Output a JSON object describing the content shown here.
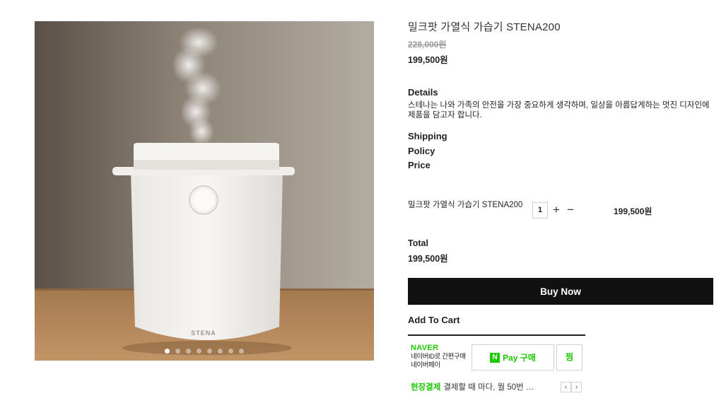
{
  "product": {
    "title": "밀크팟 가열식 가습기 STENA200",
    "original_price": "228,000원",
    "sale_price": "199,500원",
    "image_brand_text": "STENA",
    "gallery_dots": 8,
    "gallery_active_dot": 1
  },
  "details": {
    "heading": "Details",
    "text": "스테나는 나와 가족의 안전을 가장 중요하게 생각하며, 일상을 아름답게하는 멋진 디자인에 제품을 담고자 합니다."
  },
  "meta_links": {
    "shipping": "Shipping",
    "policy": "Policy",
    "price": "Price"
  },
  "option": {
    "name": "밀크팟 가열식 가습기 STENA200",
    "quantity": "1",
    "plus_label": "+",
    "minus_label": "−",
    "price": "199,500원"
  },
  "total": {
    "label": "Total",
    "value": "199,500원"
  },
  "buttons": {
    "buy_now": "Buy Now",
    "add_to_cart": "Add To Cart"
  },
  "naver_pay": {
    "logo": "NAVER",
    "description_line1": "네이버ID로 간편구매",
    "description_line2": "네이버페이",
    "badge": "N",
    "pay_label": "Pay 구매",
    "wish_label": "찜",
    "notice_tag": "현장결제",
    "notice_text": "결제할 때 마다, 월 50번 …",
    "prev_label": "‹",
    "next_label": "›"
  },
  "colors": {
    "naver_green": "#1ec800",
    "buy_button": "#111111"
  }
}
